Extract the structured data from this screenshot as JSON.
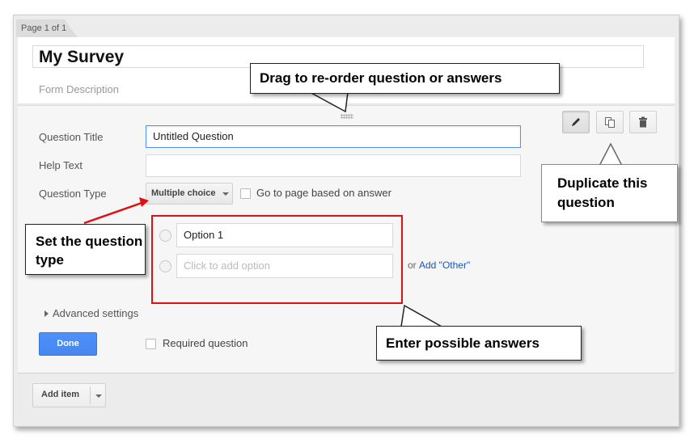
{
  "page_tab": "Page 1 of 1",
  "form": {
    "title": "My Survey",
    "description_placeholder": "Form Description"
  },
  "question": {
    "title_label": "Question Title",
    "title_value": "Untitled Question",
    "help_label": "Help Text",
    "help_value": "",
    "type_label": "Question Type",
    "type_value": "Multiple choice",
    "go_to_page_label": "Go to page based on answer",
    "options": [
      {
        "value": "Option 1"
      },
      {
        "placeholder": "Click to add option"
      }
    ],
    "or_text": "or",
    "add_other": "Add \"Other\"",
    "advanced_settings": "Advanced settings",
    "done_label": "Done",
    "required_label": "Required question"
  },
  "toolbar": {
    "icons": [
      "pencil-icon",
      "duplicate-icon",
      "trash-icon"
    ]
  },
  "add_item_label": "Add item",
  "callouts": {
    "drag": "Drag to re-order question or answers",
    "duplicate": "Duplicate this question",
    "type": "Set the question type",
    "answers": "Enter possible answers"
  },
  "colors": {
    "accent_blue": "#4d90fe",
    "link_blue": "#1155cc",
    "annotation_red": "#e01010"
  }
}
